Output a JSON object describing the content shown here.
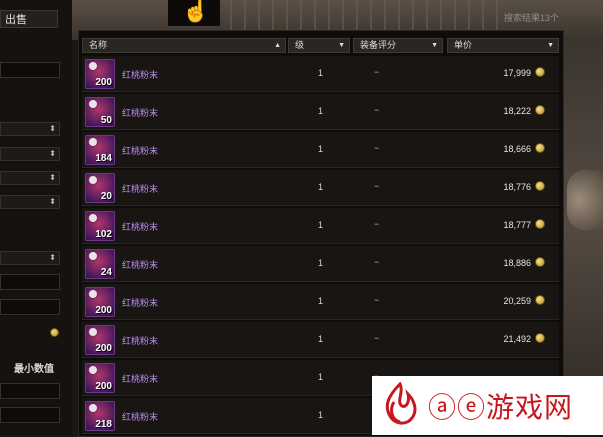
{
  "left_panel": {
    "sell_tab": "出售",
    "min_value_label": "最小数值"
  },
  "header": {
    "result_count": "搜索结果13个",
    "columns": [
      "名称",
      "级",
      "装备评分",
      "单价"
    ]
  },
  "items": [
    {
      "qty": "200",
      "name": "红桃粉末",
      "level": "1",
      "score": "−",
      "price": "17,999"
    },
    {
      "qty": "50",
      "name": "红桃粉末",
      "level": "1",
      "score": "−",
      "price": "18,222"
    },
    {
      "qty": "184",
      "name": "红桃粉末",
      "level": "1",
      "score": "−",
      "price": "18,666"
    },
    {
      "qty": "20",
      "name": "红桃粉末",
      "level": "1",
      "score": "−",
      "price": "18,776"
    },
    {
      "qty": "102",
      "name": "红桃粉末",
      "level": "1",
      "score": "−",
      "price": "18,777"
    },
    {
      "qty": "24",
      "name": "红桃粉末",
      "level": "1",
      "score": "−",
      "price": "18,886"
    },
    {
      "qty": "200",
      "name": "红桃粉末",
      "level": "1",
      "score": "−",
      "price": "20,259"
    },
    {
      "qty": "200",
      "name": "红桃粉末",
      "level": "1",
      "score": "−",
      "price": "21,492"
    },
    {
      "qty": "200",
      "name": "红桃粉末",
      "level": "1",
      "score": "−",
      "price": ""
    },
    {
      "qty": "218",
      "name": "红桃粉末",
      "level": "1",
      "score": "−",
      "price": ""
    }
  ],
  "watermark": {
    "text": "ⓐⓔ游戏网"
  },
  "icons": {
    "cursor": "hand-pointer-icon",
    "currency": "gold-coin-icon",
    "sort": "triangle-icon"
  }
}
